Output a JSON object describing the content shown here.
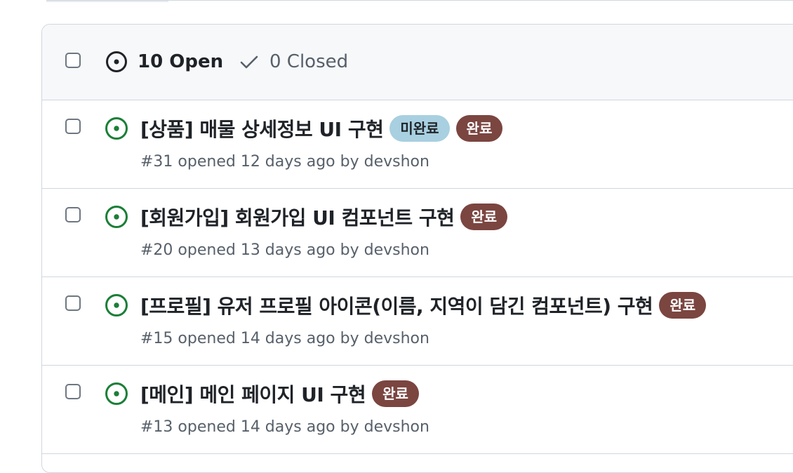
{
  "colors": {
    "open_icon": "#1a7f37",
    "label_incomplete": "#a8d0e0",
    "label_complete": "#7b4540",
    "header_bg": "#f6f8fa",
    "border": "#d0d7de",
    "muted_text": "#57606a"
  },
  "header": {
    "open_label": "10 Open",
    "closed_label": "0 Closed",
    "open_icon": "issue-opened-icon",
    "closed_icon": "check-icon"
  },
  "issues": [
    {
      "title": "[상품] 매물 상세정보 UI 구현",
      "meta": "#31 opened 12 days ago by devshon",
      "labels": [
        "미완료",
        "완료"
      ]
    },
    {
      "title": "[회원가입] 회원가입 UI 컴포넌트 구현",
      "meta": "#20 opened 13 days ago by devshon",
      "labels": [
        "완료"
      ]
    },
    {
      "title": "[프로필] 유저 프로필 아이콘(이름, 지역이 담긴 컴포넌트) 구현",
      "meta": "#15 opened 14 days ago by devshon",
      "labels": [
        "완료"
      ]
    },
    {
      "title": "[메인] 메인 페이지 UI 구현",
      "meta": "#13 opened 14 days ago by devshon",
      "labels": [
        "완료"
      ]
    }
  ]
}
